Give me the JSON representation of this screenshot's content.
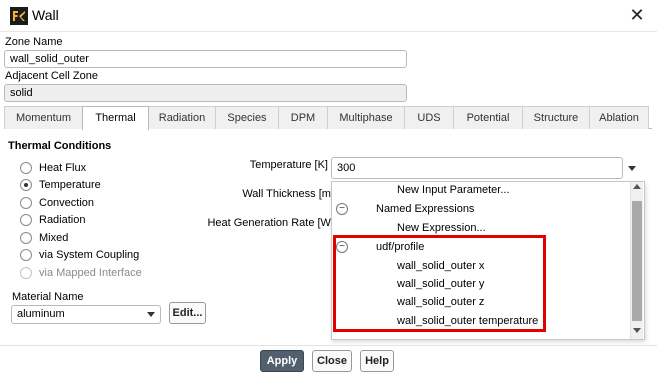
{
  "window": {
    "title": "Wall",
    "icon": "fluent-app-icon",
    "close_glyph": "✕"
  },
  "zone": {
    "name_label": "Zone Name",
    "name_value": "wall_solid_outer",
    "adjacent_label": "Adjacent Cell Zone",
    "adjacent_value": "solid"
  },
  "tabs": [
    {
      "label": "Momentum",
      "active": false
    },
    {
      "label": "Thermal",
      "active": true
    },
    {
      "label": "Radiation",
      "active": false
    },
    {
      "label": "Species",
      "active": false
    },
    {
      "label": "DPM",
      "active": false
    },
    {
      "label": "Multiphase",
      "active": false
    },
    {
      "label": "UDS",
      "active": false
    },
    {
      "label": "Potential",
      "active": false
    },
    {
      "label": "Structure",
      "active": false
    },
    {
      "label": "Ablation",
      "active": false
    }
  ],
  "thermal": {
    "conditions_title": "Thermal Conditions",
    "options": [
      {
        "label": "Heat Flux",
        "checked": false,
        "disabled": false
      },
      {
        "label": "Temperature",
        "checked": true,
        "disabled": false
      },
      {
        "label": "Convection",
        "checked": false,
        "disabled": false
      },
      {
        "label": "Radiation",
        "checked": false,
        "disabled": false
      },
      {
        "label": "Mixed",
        "checked": false,
        "disabled": false
      },
      {
        "label": "via System Coupling",
        "checked": false,
        "disabled": false
      },
      {
        "label": "via Mapped Interface",
        "checked": false,
        "disabled": true
      }
    ],
    "temperature_label": "Temperature [K]",
    "temperature_value": "300",
    "wall_thickness_label": "Wall Thickness [m]",
    "heat_generation_label": "Heat Generation Rate [W/",
    "material_label": "Material Name",
    "material_value": "aluminum",
    "edit_label": "Edit..."
  },
  "dropdown": {
    "items": [
      {
        "label": "New Input Parameter...",
        "kind": "action"
      },
      {
        "label": "Named Expressions",
        "kind": "group",
        "toggle": "⊖"
      },
      {
        "label": "New Expression...",
        "kind": "action"
      },
      {
        "label": "udf/profile",
        "kind": "group",
        "toggle": "⊖"
      },
      {
        "label": "wall_solid_outer x",
        "kind": "option"
      },
      {
        "label": "wall_solid_outer y",
        "kind": "option"
      },
      {
        "label": "wall_solid_outer z",
        "kind": "option"
      },
      {
        "label": "wall_solid_outer temperature",
        "kind": "option"
      }
    ],
    "highlight_color": "#e00000"
  },
  "buttons": {
    "apply": "Apply",
    "close": "Close",
    "help": "Help"
  },
  "colors": {
    "apply_bg": "#52606e",
    "highlight": "#e00000"
  }
}
